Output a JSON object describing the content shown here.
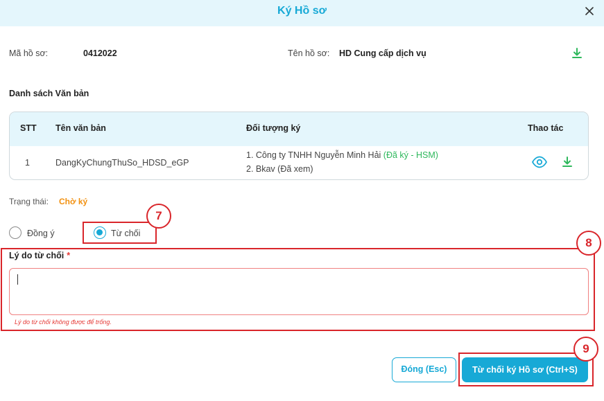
{
  "modal": {
    "title": "Ký Hồ sơ"
  },
  "info": {
    "code_label": "Mã hồ sơ:",
    "code_value": "0412022",
    "name_label": "Tên hồ sơ:",
    "name_value": "HD Cung cấp dịch vụ"
  },
  "documents": {
    "section_title": "Danh sách Văn bản",
    "columns": [
      "STT",
      "Tên văn bản",
      "Đối tượng ký",
      "Thao tác"
    ],
    "rows": [
      {
        "index": "1",
        "name": "DangKyChungThuSo_HDSD_eGP",
        "signer_1": "1. Công ty TNHH Nguyễn Minh Hải",
        "signer_1_status": "(Đã ký - HSM)",
        "signer_2": "2. Bkav (Đã xem)"
      }
    ]
  },
  "status": {
    "label": "Trạng thái:",
    "value": "Chờ ký"
  },
  "decision": {
    "options": [
      "Đồng ý",
      "Từ chối"
    ],
    "selected": "Từ chối"
  },
  "reason": {
    "label": "Lý do từ chối",
    "required_mark": "*",
    "value": "",
    "error": "Lý do từ chối không được để trống."
  },
  "actions": {
    "close_label": "Đóng (Esc)",
    "reject_label": "Từ chối ký Hồ sơ (Ctrl+S)"
  },
  "annotations": {
    "radio_callout": "7",
    "reason_callout": "8",
    "button_callout": "9"
  },
  "colors": {
    "accent": "#17a9d6",
    "header_bg": "#e4f6fc",
    "callout_red": "#d9252a",
    "pending_orange": "#f29111",
    "signed_green": "#2eb85c",
    "download_green": "#2eb85c"
  },
  "icons": [
    "close-icon",
    "download-icon",
    "eye-icon",
    "download-icon"
  ]
}
